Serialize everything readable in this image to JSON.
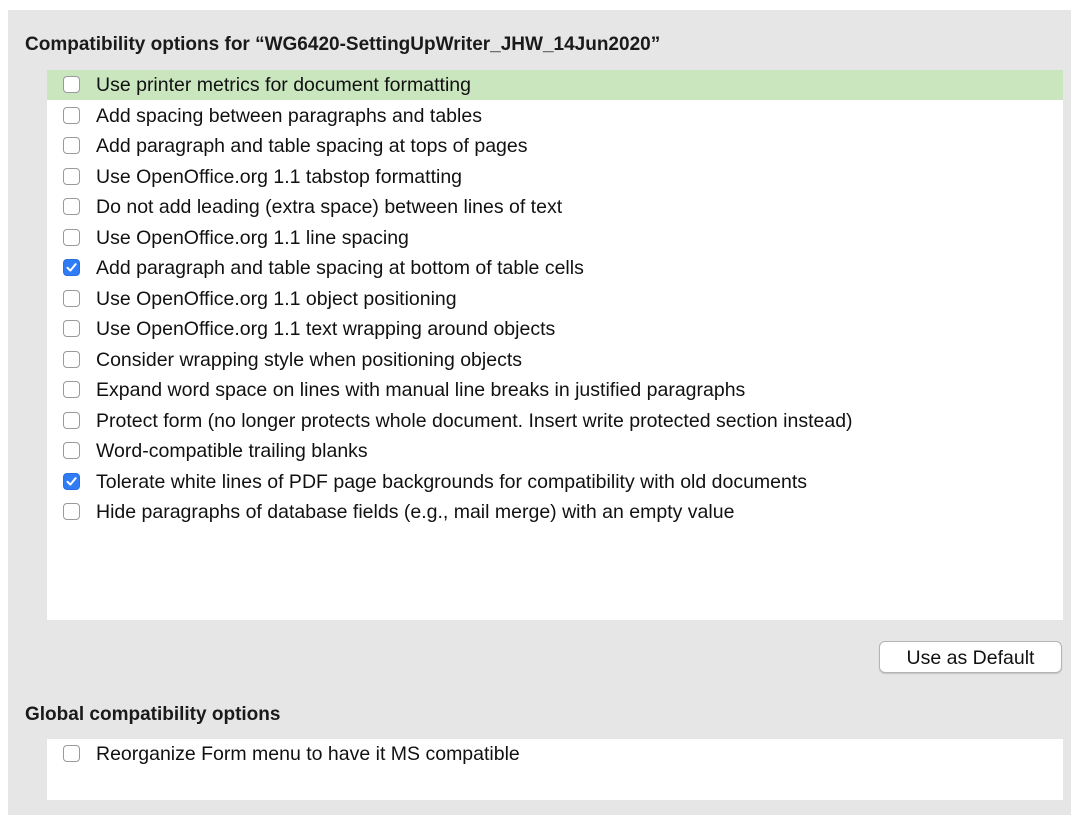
{
  "document_section": {
    "title": "Compatibility options for “WG6420-SettingUpWriter_JHW_14Jun2020”",
    "options": [
      {
        "label": "Use printer metrics for document formatting",
        "checked": false,
        "selected": true
      },
      {
        "label": "Add spacing between paragraphs and tables",
        "checked": false
      },
      {
        "label": "Add paragraph and table spacing at tops of pages",
        "checked": false
      },
      {
        "label": "Use OpenOffice.org 1.1 tabstop formatting",
        "checked": false
      },
      {
        "label": "Do not add leading (extra space) between lines of text",
        "checked": false
      },
      {
        "label": "Use OpenOffice.org 1.1 line spacing",
        "checked": false
      },
      {
        "label": "Add paragraph and table spacing at bottom of table cells",
        "checked": true
      },
      {
        "label": "Use OpenOffice.org 1.1 object positioning",
        "checked": false
      },
      {
        "label": "Use OpenOffice.org 1.1 text wrapping around objects",
        "checked": false
      },
      {
        "label": "Consider wrapping style when positioning objects",
        "checked": false
      },
      {
        "label": "Expand word space on lines with manual line breaks in justified paragraphs",
        "checked": false
      },
      {
        "label": "Protect form (no longer protects whole document. Insert write protected section instead)",
        "checked": false
      },
      {
        "label": "Word-compatible trailing blanks",
        "checked": false
      },
      {
        "label": "Tolerate white lines of PDF page backgrounds for compatibility with old documents",
        "checked": true
      },
      {
        "label": "Hide paragraphs of database fields (e.g., mail merge) with an empty value",
        "checked": false
      }
    ],
    "default_button_label": "Use as Default"
  },
  "global_section": {
    "title": "Global compatibility options",
    "options": [
      {
        "label": "Reorganize Form menu to have it MS compatible",
        "checked": false
      }
    ]
  },
  "colors": {
    "selected_row": "#c9e6bf",
    "checkbox_checked": "#2f7cf6",
    "panel_background": "#e6e6e6"
  }
}
